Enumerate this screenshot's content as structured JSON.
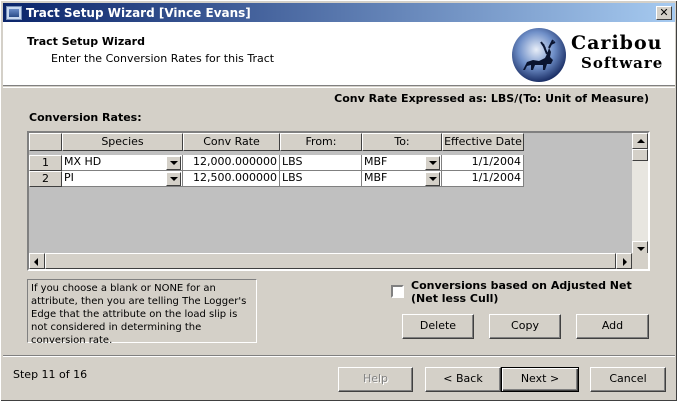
{
  "window": {
    "title": "Tract Setup Wizard [Vince Evans]",
    "close_glyph": "✕"
  },
  "header": {
    "title": "Tract Setup Wizard",
    "subtitle": "Enter the Conversion Rates for this Tract",
    "logo_line1": "Caribou",
    "logo_line2": "Software"
  },
  "conv_expressed": "Conv Rate Expressed as: LBS/(To: Unit of Measure)",
  "conv_rates_label": "Conversion Rates:",
  "grid": {
    "columns": [
      "Species",
      "Conv Rate",
      "From:",
      "To:",
      "Effective Date"
    ],
    "rows": [
      {
        "num": "1",
        "species": "MX HD",
        "rate": "12,000.000000",
        "from": "LBS",
        "to": "MBF",
        "date": "1/1/2004"
      },
      {
        "num": "2",
        "species": "PI",
        "rate": "12,500.000000",
        "from": "LBS",
        "to": "MBF",
        "date": "1/1/2004"
      }
    ]
  },
  "info_text": "If you choose a blank or NONE for an attribute, then you are telling The Logger's Edge that the attribute on the load slip is not considered in determining the conversion rate.",
  "checkbox": {
    "line1": "Conversions based on Adjusted Net",
    "line2": "(Net less Cull)"
  },
  "actions": {
    "delete": "Delete",
    "copy": "Copy",
    "add": "Add"
  },
  "footer": {
    "step": "Step 11 of 16",
    "help": "Help",
    "back": "< Back",
    "next": "Next >",
    "cancel": "Cancel"
  }
}
